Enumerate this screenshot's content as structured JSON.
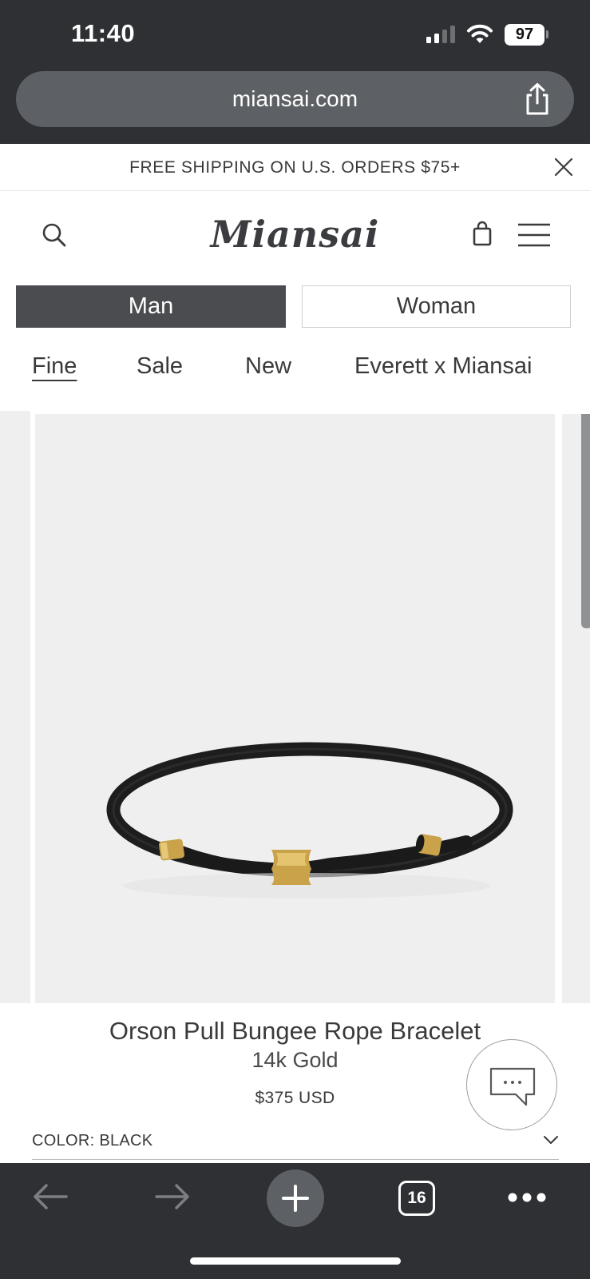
{
  "status_bar": {
    "time": "11:40",
    "battery_level": "97",
    "signal_bars_active": 2,
    "signal_bars_total": 4,
    "icons": [
      "cellular-signal-icon",
      "wifi-icon",
      "battery-icon"
    ]
  },
  "browser": {
    "url": "miansai.com",
    "share_icon": "share-icon",
    "tab_count": "16",
    "toolbar_icons": [
      "back-arrow-icon",
      "forward-arrow-icon",
      "plus-icon",
      "tabs-icon",
      "more-icon"
    ]
  },
  "promo": {
    "text": "FREE SHIPPING ON U.S. ORDERS $75+",
    "close_icon": "close-icon"
  },
  "header": {
    "logo_text": "Miansai",
    "icons": [
      "search-icon",
      "shopping-bag-icon",
      "hamburger-menu-icon"
    ]
  },
  "gender_toggle": {
    "options": [
      "Man",
      "Woman"
    ],
    "selected": "Man"
  },
  "categories": {
    "items": [
      "Fine",
      "Sale",
      "New",
      "Everett x Miansai"
    ],
    "active": "Fine"
  },
  "product": {
    "title": "Orson Pull Bungee Rope Bracelet",
    "variant": "14k Gold",
    "price": "$375 USD",
    "color_label": "COLOR: BLACK",
    "chat_icon": "chat-bubble-icon"
  },
  "colors": {
    "dark_chrome": "#2e3034",
    "url_bar": "#5d6165",
    "selected_toggle": "#4a4c50",
    "image_background": "#efefef",
    "text": "#3a3a3a",
    "gold": "#c9a24a"
  }
}
